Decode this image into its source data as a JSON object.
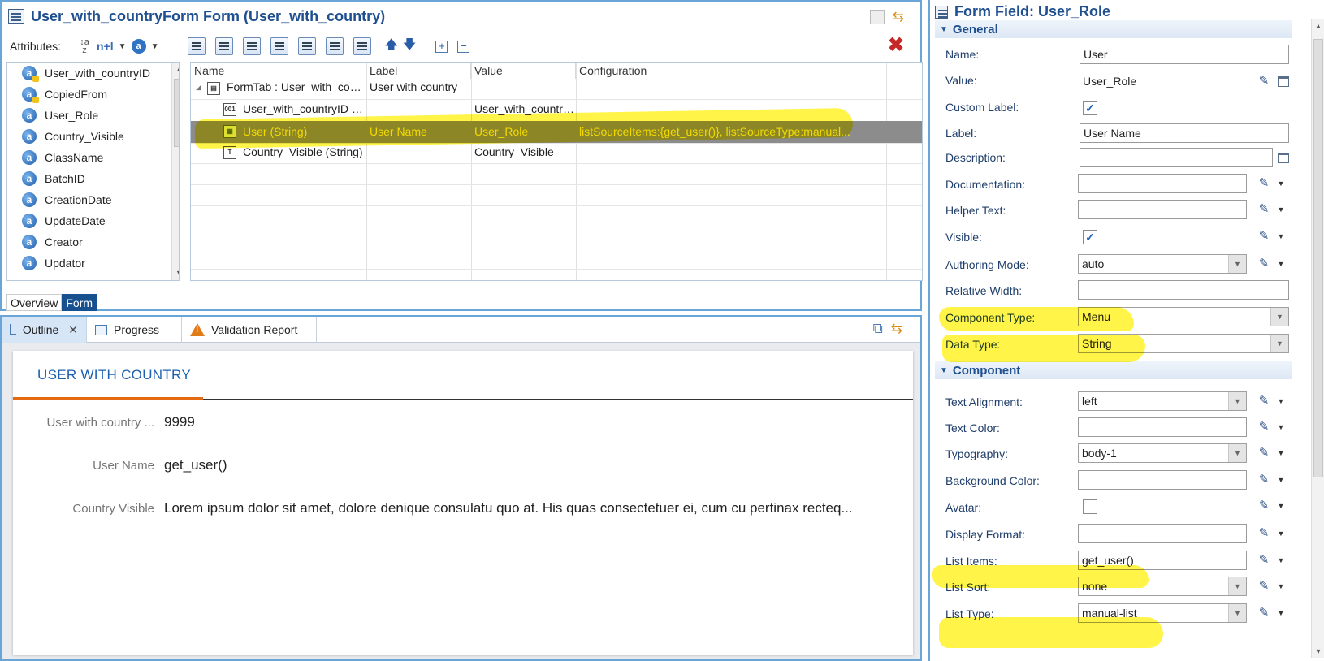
{
  "editor": {
    "title": "User_with_countryForm Form (User_with_country)",
    "attributes_label": "Attributes:",
    "naming_label": "n+l",
    "attribute_list": [
      {
        "name": "User_with_countryID",
        "icon": "key-attribute-icon"
      },
      {
        "name": "CopiedFrom",
        "icon": "key-attribute-icon"
      },
      {
        "name": "User_Role",
        "icon": "attribute-icon"
      },
      {
        "name": "Country_Visible",
        "icon": "attribute-icon"
      },
      {
        "name": "ClassName",
        "icon": "attribute-icon"
      },
      {
        "name": "BatchID",
        "icon": "attribute-icon"
      },
      {
        "name": "CreationDate",
        "icon": "attribute-icon"
      },
      {
        "name": "UpdateDate",
        "icon": "attribute-icon"
      },
      {
        "name": "Creator",
        "icon": "attribute-icon"
      },
      {
        "name": "Updator",
        "icon": "attribute-icon"
      }
    ],
    "grid": {
      "columns": [
        "Name",
        "Label",
        "Value",
        "Configuration"
      ],
      "rows": [
        {
          "name": "FormTab : User_with_coun...",
          "label": "User with country",
          "value": "",
          "config": ""
        },
        {
          "name": "User_with_countryID (L...",
          "label": "",
          "value": "User_with_country...",
          "config": ""
        },
        {
          "name": "User (String)",
          "label": "User Name",
          "value": "User_Role",
          "config": "listSourceItems:{get_user()}, listSourceType:manual..."
        },
        {
          "name": "Country_Visible (String)",
          "label": "",
          "value": "Country_Visible",
          "config": ""
        }
      ]
    },
    "bottom_tabs": [
      "Overview",
      "Form"
    ]
  },
  "outline": {
    "tabs": [
      {
        "label": "Outline",
        "icon": "outline-icon",
        "active": true
      },
      {
        "label": "Progress",
        "icon": "progress-icon"
      },
      {
        "label": "Validation Report",
        "icon": "warning-icon"
      }
    ],
    "preview": {
      "tab_title": "USER WITH COUNTRY",
      "fields": [
        {
          "label": "User with country ...",
          "value": "9999"
        },
        {
          "label": "User Name",
          "value": "get_user()"
        },
        {
          "label": "Country Visible",
          "value": "Lorem ipsum dolor sit amet, dolore denique consulatu quo at. His quas consectetuer ei, cum cu pertinax recteq..."
        }
      ]
    }
  },
  "props": {
    "title": "Form Field: User_Role",
    "general_header": "General",
    "component_header": "Component",
    "name_label": "Name:",
    "name_value": "User",
    "value_label": "Value:",
    "value_value": "User_Role",
    "custom_label_label": "Custom Label:",
    "label_label": "Label:",
    "label_value": "User Name",
    "description_label": "Description:",
    "documentation_label": "Documentation:",
    "helper_text_label": "Helper Text:",
    "visible_label": "Visible:",
    "authoring_mode_label": "Authoring Mode:",
    "authoring_mode_value": "auto",
    "relative_width_label": "Relative Width:",
    "component_type_label": "Component Type:",
    "component_type_value": "Menu",
    "data_type_label": "Data Type:",
    "data_type_value": "String",
    "text_alignment_label": "Text Alignment:",
    "text_alignment_value": "left",
    "text_color_label": "Text Color:",
    "typography_label": "Typography:",
    "typography_value": "body-1",
    "background_color_label": "Background Color:",
    "avatar_label": "Avatar:",
    "display_format_label": "Display Format:",
    "list_items_label": "List Items:",
    "list_items_value": "get_user()",
    "list_sort_label": "List Sort:",
    "list_sort_value": "none",
    "list_type_label": "List Type:",
    "list_type_value": "manual-list"
  },
  "colors": {
    "highlight": "#fff000",
    "selected_row": "#8c8c8c",
    "accent": "#1f4f8f",
    "tab_underline": "#e46a12"
  }
}
